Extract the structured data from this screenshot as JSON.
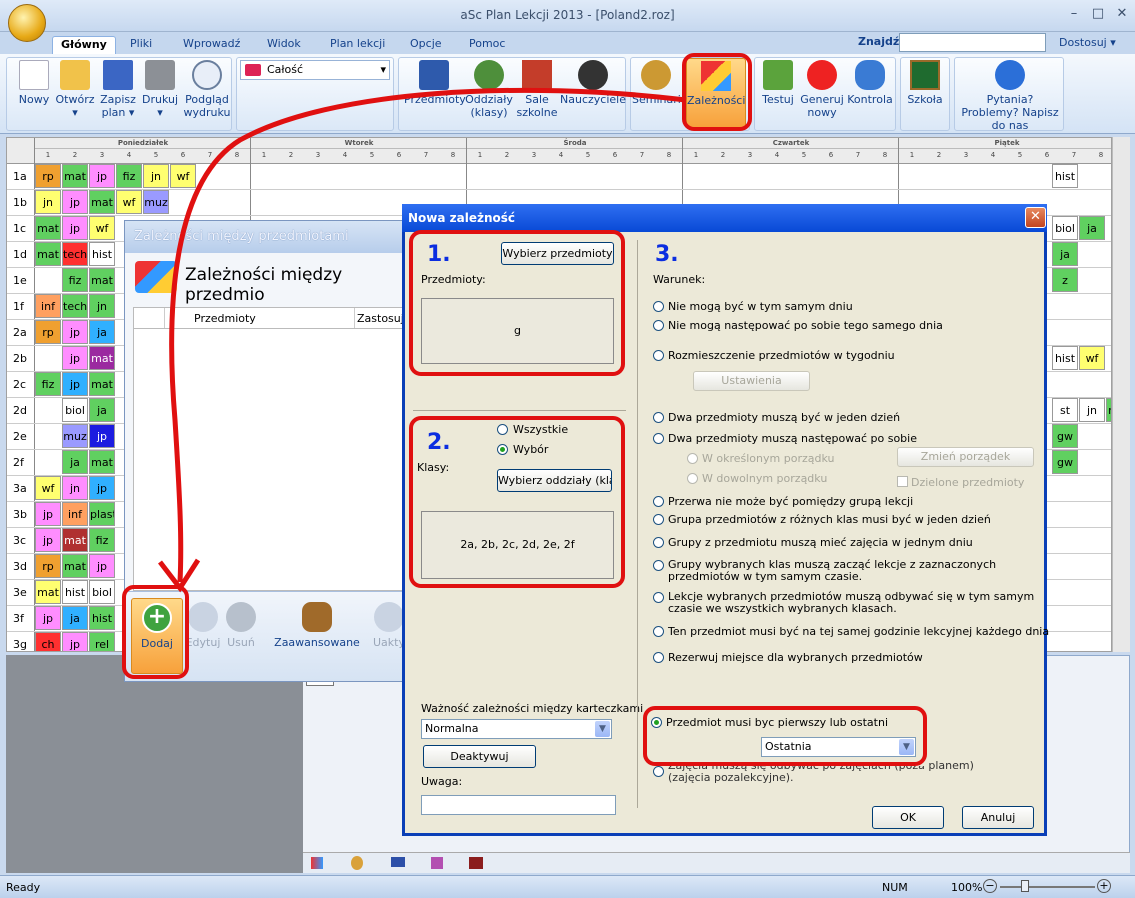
{
  "window": {
    "title": "aSc Plan Lekcji 2013  -  [Poland2.roz]"
  },
  "tabs": [
    "Główny",
    "Pliki",
    "Wprowadź",
    "Widok",
    "Plan lekcji",
    "Opcje",
    "Pomoc"
  ],
  "search": {
    "label": "Znajdź:",
    "value": ""
  },
  "customize": "Dostosuj",
  "ribbon": {
    "file": [
      "Nowy",
      "Otwórz",
      "Zapisz plan",
      "Drukuj",
      "Podgląd wydruku"
    ],
    "scope": "Całość",
    "data": [
      "Przedmioty",
      "Oddziały (klasy)",
      "Sale szkolne",
      "Nauczyciele",
      "Seminaria",
      "Zależności"
    ],
    "gen": [
      "Testuj",
      "Generuj nowy",
      "Kontrola"
    ],
    "school": "Szkoła",
    "help": "Pytania? Problemy? Napisz do nas"
  },
  "days": [
    "Poniedziałek",
    "Wtorek",
    "Środa",
    "Czwartek",
    "Piątek"
  ],
  "periods": [
    "1",
    "2",
    "3",
    "4",
    "5",
    "6",
    "7",
    "8"
  ],
  "classes": [
    "1a",
    "1b",
    "1c",
    "1d",
    "1e",
    "1f",
    "2a",
    "2b",
    "2c",
    "2d",
    "2e",
    "2f",
    "3a",
    "3b",
    "3c",
    "3d",
    "3e",
    "3f",
    "3g"
  ],
  "rows": {
    "1a": [
      [
        "rp",
        "#f0a030"
      ],
      [
        "mat",
        "#60d060"
      ],
      [
        "jp",
        "#ff8dff"
      ],
      [
        "fiz",
        "#60d060"
      ],
      [
        "jn",
        "#ffff70"
      ],
      [
        "wf",
        "#ffff70"
      ],
      [
        "",
        ""
      ],
      [
        "",
        ""
      ]
    ],
    "1b": [
      [
        "jn",
        "#ffff70"
      ],
      [
        "jp",
        "#ff8dff"
      ],
      [
        "mat",
        "#60d060"
      ],
      [
        "wf",
        "#ffff70"
      ],
      [
        "muz",
        "#9a9aff"
      ],
      [
        "",
        ""
      ],
      [
        "",
        ""
      ],
      [
        "",
        ""
      ]
    ],
    "1c": [
      [
        "mat",
        "#60d060"
      ],
      [
        "jp",
        "#ff8dff"
      ],
      [
        "wf",
        "#ffff70"
      ],
      [
        "",
        ""
      ]
    ],
    "1d": [
      [
        "mat",
        "#60d060"
      ],
      [
        "tech",
        "#ff3030"
      ],
      [
        "hist",
        "#ffffff"
      ]
    ],
    "1e": [
      [
        "",
        ""
      ],
      [
        "fiz",
        "#60d060"
      ],
      [
        "mat",
        "#60d060"
      ]
    ],
    "1f": [
      [
        "inf",
        "#ffa060"
      ],
      [
        "tech",
        "#60d060"
      ],
      [
        "jn",
        "#60d060"
      ]
    ],
    "2a": [
      [
        "rp",
        "#f0a030"
      ],
      [
        "jp",
        "#ff8dff"
      ],
      [
        "ja",
        "#30b0ff"
      ]
    ],
    "2b": [
      [
        "",
        ""
      ],
      [
        "jp",
        "#ff8dff"
      ],
      [
        "mat",
        "#9b2aa0"
      ]
    ],
    "2c": [
      [
        "fiz",
        "#60d060"
      ],
      [
        "jp",
        "#30b0ff"
      ],
      [
        "mat",
        "#60d060"
      ]
    ],
    "2d": [
      [
        "",
        ""
      ],
      [
        "biol",
        "#ffffff"
      ],
      [
        "ja",
        "#60d060"
      ]
    ],
    "2e": [
      [
        "",
        ""
      ],
      [
        "muz",
        "#9a9aff"
      ],
      [
        "jp",
        "#1c1ce0"
      ]
    ],
    "2f": [
      [
        "",
        ""
      ],
      [
        "ja",
        "#60d060"
      ],
      [
        "mat",
        "#60d060"
      ]
    ],
    "3a": [
      [
        "wf",
        "#ffff70"
      ],
      [
        "jn",
        "#ff8dff"
      ],
      [
        "jp",
        "#30b0ff"
      ]
    ],
    "3b": [
      [
        "jp",
        "#ff8dff"
      ],
      [
        "inf",
        "#ffa060"
      ],
      [
        "plast",
        "#60d060"
      ]
    ],
    "3c": [
      [
        "jp",
        "#ff8dff"
      ],
      [
        "mat",
        "#b03030"
      ],
      [
        "fiz",
        "#60d060"
      ]
    ],
    "3d": [
      [
        "rp",
        "#f0a030"
      ],
      [
        "mat",
        "#60d060"
      ],
      [
        "jp",
        "#ff8dff"
      ]
    ],
    "3e": [
      [
        "mat",
        "#ffff70"
      ],
      [
        "hist",
        "#ffffff"
      ],
      [
        "biol",
        "#ffffff"
      ]
    ],
    "3f": [
      [
        "jp",
        "#ff8dff"
      ],
      [
        "ja",
        "#30b0ff"
      ],
      [
        "hist",
        "#60d060"
      ]
    ],
    "3g": [
      [
        "ch",
        "#ff3030"
      ],
      [
        "jp",
        "#ff8dff"
      ],
      [
        "rel",
        "#60d060"
      ]
    ]
  },
  "right_cells": {
    "1a": [
      "hist"
    ],
    "1c": [
      "biol",
      "ja"
    ],
    "1d": [
      "ja"
    ],
    "1e": [
      "z"
    ],
    "2b": [
      "hist",
      "wf"
    ],
    "2d": [
      "st",
      "jn",
      "mat"
    ],
    "2e": [
      "gw"
    ],
    "2f": [
      "gw"
    ]
  },
  "dep_panel": {
    "title": "Zależności między przedmiotami",
    "heading": "Zależności między przedmio",
    "columns": [
      "Przedmioty",
      "Zastosuj"
    ],
    "toolbar": [
      "Dodaj",
      "Edytuj",
      "Usuń",
      "Zaawansowane",
      "Uakty"
    ]
  },
  "dialog": {
    "title": "Nowa zależność",
    "n1": "1.",
    "n2": "2.",
    "n3": "3.",
    "select_subjects": "Wybierz przedmioty",
    "subjects_label": "Przedmioty:",
    "subjects_value": "g",
    "classes_label": "Klasy:",
    "all": "Wszystkie",
    "choice": "Wybór",
    "select_classes": "Wybierz oddziały (klasy)",
    "classes_value": "2a, 2b, 2c, 2d, 2e, 2f",
    "condition_label": "Warunek:",
    "conditions": [
      "Nie mogą być w tym samym dniu",
      "Nie mogą następować po sobie tego samego dnia",
      "Rozmieszczenie przedmiotów w tygodniu",
      "Dwa przedmioty muszą być w jeden dzień",
      "Dwa przedmioty muszą następować po sobie",
      "Przerwa nie może być pomiędzy grupą lekcji",
      "Grupa przedmiotów z różnych klas musi być w jeden dzień",
      "Grupy z przedmiotu muszą mieć zajęcia w jednym dniu",
      "Grupy wybranych klas muszą zacząć lekcje z zaznaczonych przedmiotów w tym samym czasie.",
      "Lekcje wybranych przedmiotów muszą odbywać się w tym samym czasie we wszystkich wybranych klasach.",
      "Ten przedmiot musi być na tej samej godzinie lekcyjnej każdego dnia",
      "Rezerwuj miejsce dla wybranych przedmiotów",
      "Przedmiot musi byc pierwszy lub ostatni",
      "Zajęcia muszą się odbywać po zajęciach (poza planem) (zajęcia pozalekcyjne)."
    ],
    "settings_btn": "Ustawienia",
    "fixed_order": "W określonym porządku",
    "any_order": "W dowolnym porządku",
    "change_order": "Zmień porządek",
    "split": "Dzielone przedmioty",
    "last_select": "Ostatnia",
    "importance_label": "Ważność zależności między karteczkami:",
    "importance_value": "Normalna",
    "deactivate": "Deaktywuj",
    "note_label": "Uwaga:",
    "ok": "OK",
    "cancel": "Anuluj"
  },
  "status": {
    "left": "Ready",
    "num": "NUM",
    "zoom": "100%"
  },
  "colors": {
    "highlight": "#e01010",
    "accent": "#0a3fb7"
  }
}
